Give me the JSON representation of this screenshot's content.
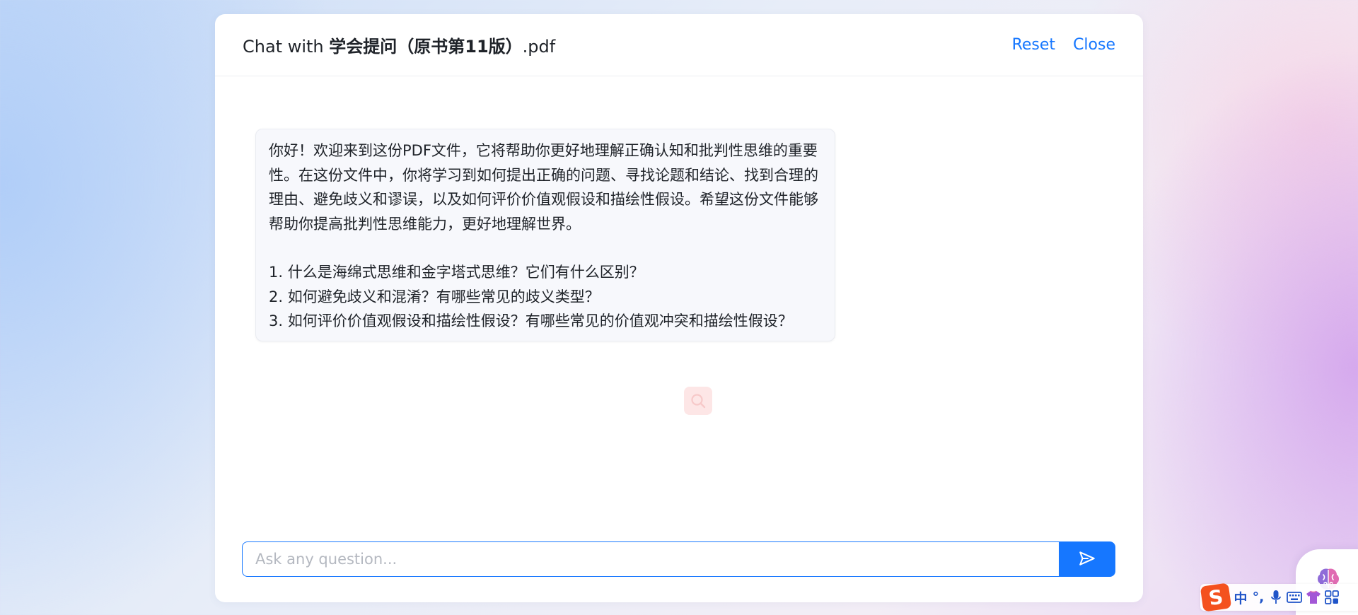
{
  "dialog": {
    "title_prefix": "Chat with ",
    "file_name": "学会提问（原书第11版）",
    "file_ext": ".pdf",
    "reset_label": "Reset",
    "close_label": "Close"
  },
  "message": {
    "intro": "你好！欢迎来到这份PDF文件，它将帮助你更好地理解正确认知和批判性思维的重要性。在这份文件中，你将学习到如何提出正确的问题、寻找论题和结论、找到合理的理由、避免歧义和谬误，以及如何评价价值观假设和描绘性假设。希望这份文件能够帮助你提高批判性思维能力，更好地理解世界。",
    "questions": [
      "1. 什么是海绵式思维和金字塔式思维？它们有什么区别？",
      "2. 如何避免歧义和混淆？有哪些常见的歧义类型？",
      "3. 如何评价价值观假设和描绘性假设？有哪些常见的价值观冲突和描绘性假设？"
    ]
  },
  "input": {
    "placeholder": "Ask any question..."
  },
  "ime": {
    "logo": "S",
    "mode": "中",
    "punct": "°,"
  },
  "icons": {
    "send": "send-icon",
    "loader": "search-icon",
    "assistant": "brain-icon",
    "mic": "microphone-icon",
    "keyboard": "keyboard-icon",
    "skin": "shirt-icon",
    "toolbox": "grid-icon"
  },
  "colors": {
    "accent": "#1677ff",
    "ime_orange": "#f4511e"
  }
}
